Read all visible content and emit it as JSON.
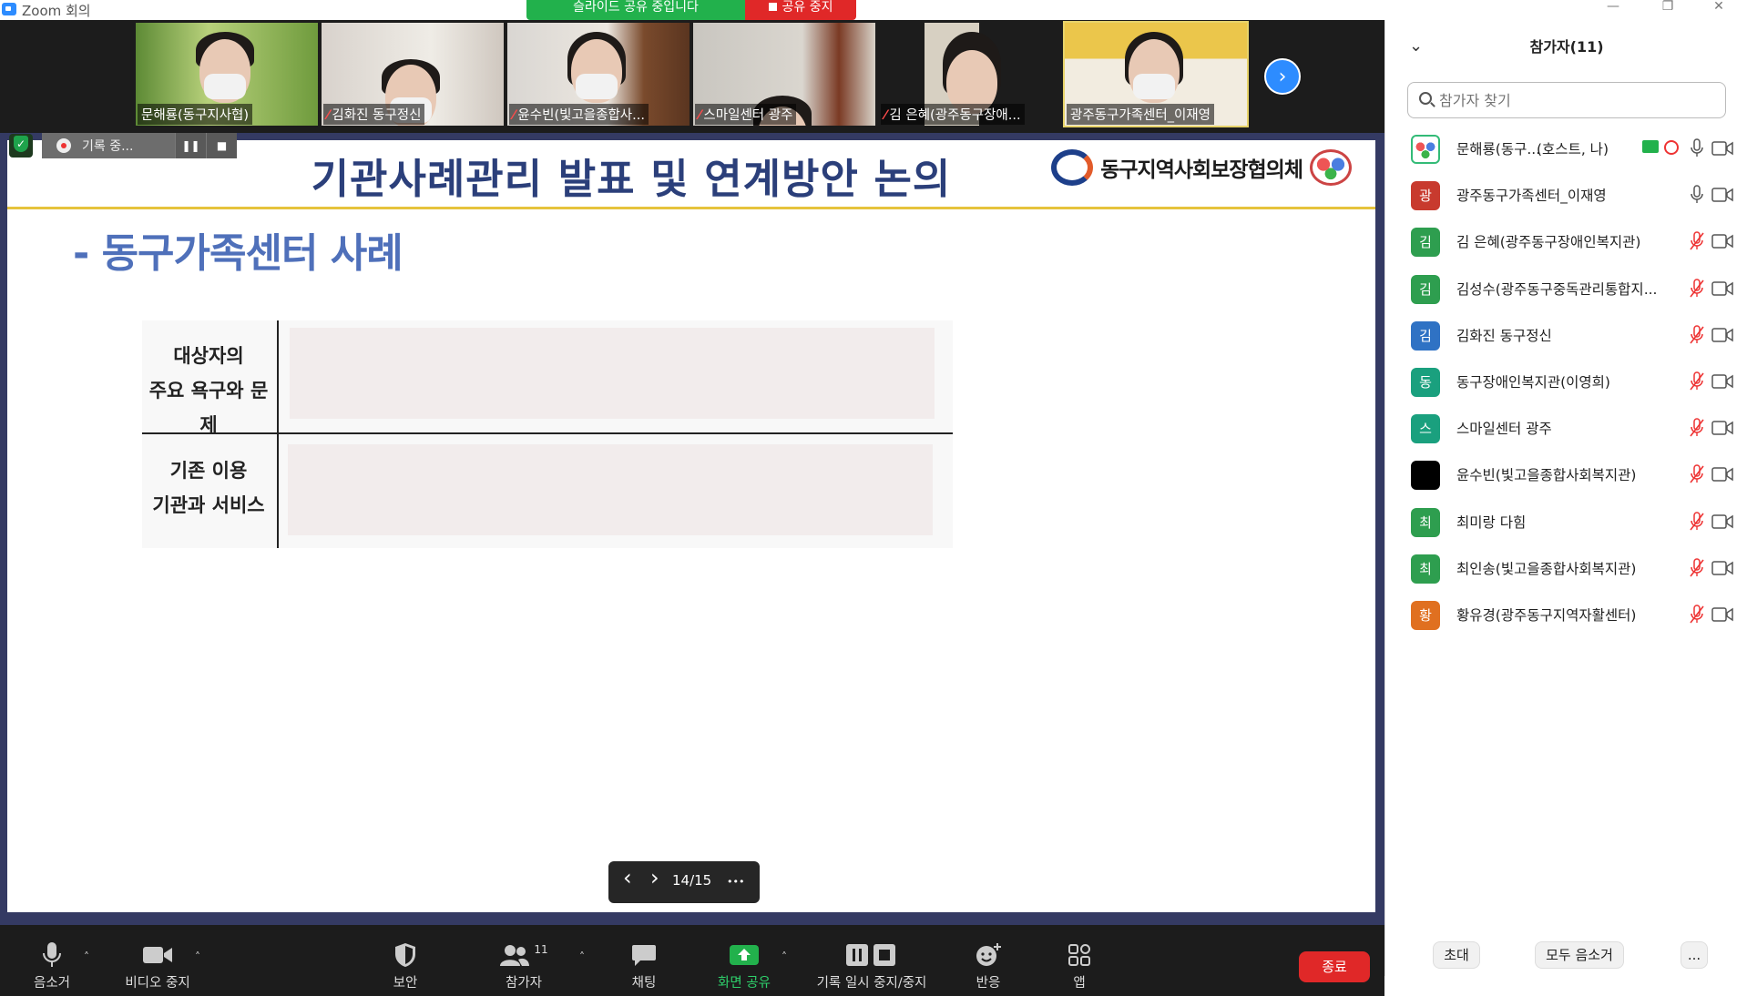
{
  "window": {
    "title": "Zoom 회의",
    "minimize": "—",
    "restore": "❐",
    "close": "✕"
  },
  "share_banner": {
    "message": "슬라이드 공유 중입니다",
    "stop_label": "공유 중지"
  },
  "thumbnails": [
    {
      "name": "문해룡(동구지사협)",
      "muted": false
    },
    {
      "name": "김화진 동구정신",
      "muted": true
    },
    {
      "name": "윤수빈(빛고을종합사...",
      "muted": true
    },
    {
      "name": "스마일센터 광주",
      "muted": true
    },
    {
      "name": "김 은혜(광주동구장애...",
      "muted": true
    },
    {
      "name": "광주동구가족센터_이재영",
      "muted": false
    }
  ],
  "recording": {
    "status": "기록 중..."
  },
  "slide": {
    "title": "기관사례관리 발표 및 연계방안 논의",
    "logo_text": "동구지역사회보장협의체",
    "subtitle": "- 동구가족센터 사례",
    "table": {
      "row1_label_line1": "대상자의",
      "row1_label_line2": "주요 욕구와 문제",
      "row2_label_line1": "기존 이용",
      "row2_label_line2": "기관과 서비스"
    }
  },
  "slide_nav": {
    "page": "14/15",
    "prev": "‹",
    "next": "›",
    "more": "•••"
  },
  "toolbar": {
    "mute": "음소거",
    "video": "비디오 중지",
    "security": "보안",
    "participants": "참가자",
    "participants_count": "11",
    "chat": "채팅",
    "share": "화면 공유",
    "record": "기록 일시 중지/중지",
    "reactions": "반응",
    "apps": "앱",
    "end": "종료"
  },
  "panel": {
    "title": "참가자(11)",
    "search_placeholder": "참가자 찾기",
    "participants": [
      {
        "initial": "",
        "name": "문해룡(동구...",
        "suffix": "(호스트, 나)",
        "color": "#ffffff",
        "muted": false,
        "host": true
      },
      {
        "initial": "광",
        "name": "광주동구가족센터_이재영",
        "color": "#c83a2e",
        "muted": false
      },
      {
        "initial": "김",
        "name": "김 은혜(광주동구장애인복지관)",
        "color": "#2e9e4f",
        "muted": true
      },
      {
        "initial": "김",
        "name": "김성수(광주동구중독관리통합지...",
        "color": "#2e9e4f",
        "muted": true
      },
      {
        "initial": "김",
        "name": "김화진 동구정신",
        "color": "#2f72c4",
        "muted": true
      },
      {
        "initial": "동",
        "name": "동구장애인복지관(이영희)",
        "color": "#1aa07e",
        "muted": true
      },
      {
        "initial": "스",
        "name": "스마일센터 광주",
        "color": "#1aa07e",
        "muted": true
      },
      {
        "initial": "",
        "name": "윤수빈(빛고을종합사회복지관)",
        "color": "#000000",
        "muted": true
      },
      {
        "initial": "최",
        "name": "최미랑 다힘",
        "color": "#2e9e4f",
        "muted": true
      },
      {
        "initial": "최",
        "name": "최인송(빛고을종합사회복지관)",
        "color": "#2e9e4f",
        "muted": true
      },
      {
        "initial": "황",
        "name": "황유경(광주동구지역자활센터)",
        "color": "#e07020",
        "muted": true
      }
    ],
    "invite": "초대",
    "mute_all": "모두 음소거",
    "more": "..."
  }
}
